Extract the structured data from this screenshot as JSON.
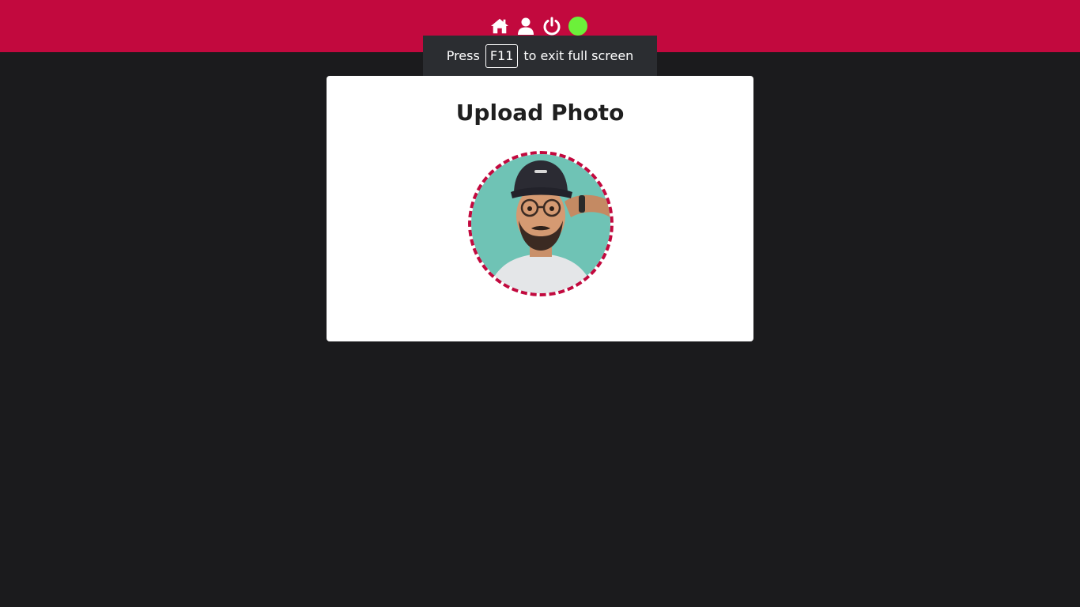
{
  "topbar": {
    "icons": [
      "home-icon",
      "user-icon",
      "power-icon"
    ],
    "status_color": "#6cf03a",
    "brand_color": "#c2093e"
  },
  "fullscreen_notice": {
    "prefix": "Press",
    "key": "F11",
    "suffix": "to exit full screen"
  },
  "card": {
    "title": "Upload Photo",
    "photo_alt": "profile-photo",
    "photo_background": "#6fc3b5"
  }
}
